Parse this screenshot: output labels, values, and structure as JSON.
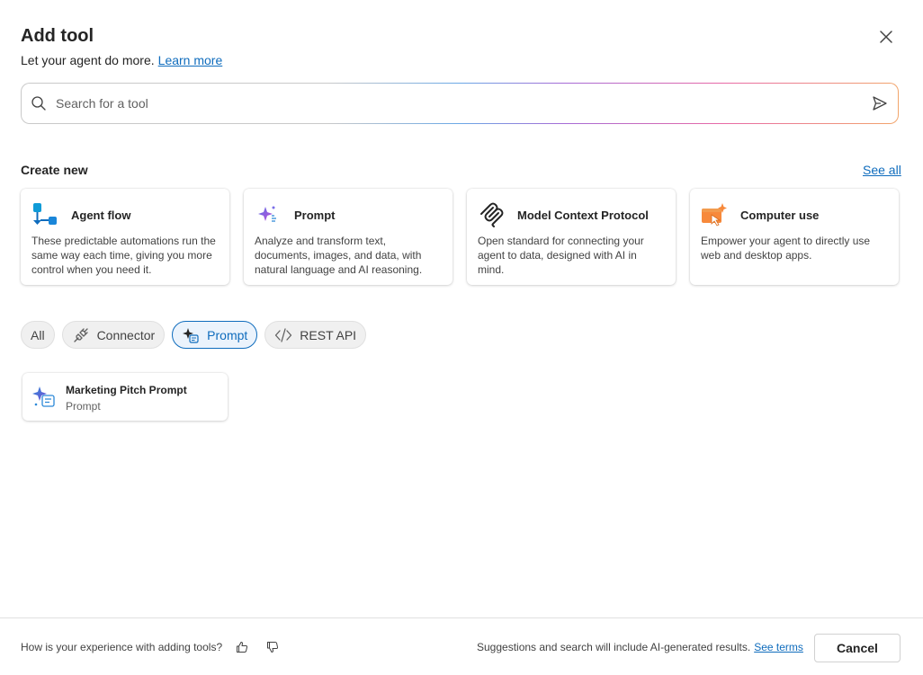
{
  "dialog": {
    "title": "Add tool",
    "subtitle": "Let your agent do more.",
    "learn_more": "Learn more",
    "close_icon": "close-icon"
  },
  "search": {
    "placeholder": "Search for a tool",
    "value": "",
    "search_icon": "search-icon",
    "send_icon": "send-icon"
  },
  "create_new": {
    "title": "Create new",
    "see_all": "See all",
    "cards": [
      {
        "icon": "agent-flow-icon",
        "title": "Agent flow",
        "description": "These predictable automations run the same way each time, giving you more control when you need it."
      },
      {
        "icon": "prompt-sparkle-icon",
        "title": "Prompt",
        "description": "Analyze and transform text, documents, images, and data, with natural language and AI reasoning."
      },
      {
        "icon": "model-context-protocol-icon",
        "title": "Model Context Protocol",
        "description": "Open standard for connecting your agent to data, designed with AI in mind."
      },
      {
        "icon": "computer-use-icon",
        "title": "Computer use",
        "description": "Empower your agent to directly use web and desktop apps."
      }
    ]
  },
  "filters": {
    "items": [
      {
        "label": "All",
        "icon": "",
        "active": false
      },
      {
        "label": "Connector",
        "icon": "connector-plug-icon",
        "active": false
      },
      {
        "label": "Prompt",
        "icon": "prompt-sparkle-icon",
        "active": true
      },
      {
        "label": "REST API",
        "icon": "code-icon",
        "active": false
      }
    ]
  },
  "results": [
    {
      "icon": "prompt-sparkle-icon",
      "title": "Marketing Pitch Prompt",
      "subtitle": "Prompt"
    }
  ],
  "footer": {
    "question": "How is your experience with adding tools?",
    "thumbs_up_icon": "thumbs-up-icon",
    "thumbs_down_icon": "thumbs-down-icon",
    "note": "Suggestions and search will include AI-generated results.",
    "see_terms": "See terms",
    "cancel": "Cancel"
  },
  "colors": {
    "accent": "#0f6cbd",
    "active_pill_bg": "#ebf3fc",
    "computer_use_orange": "#f7893b"
  }
}
